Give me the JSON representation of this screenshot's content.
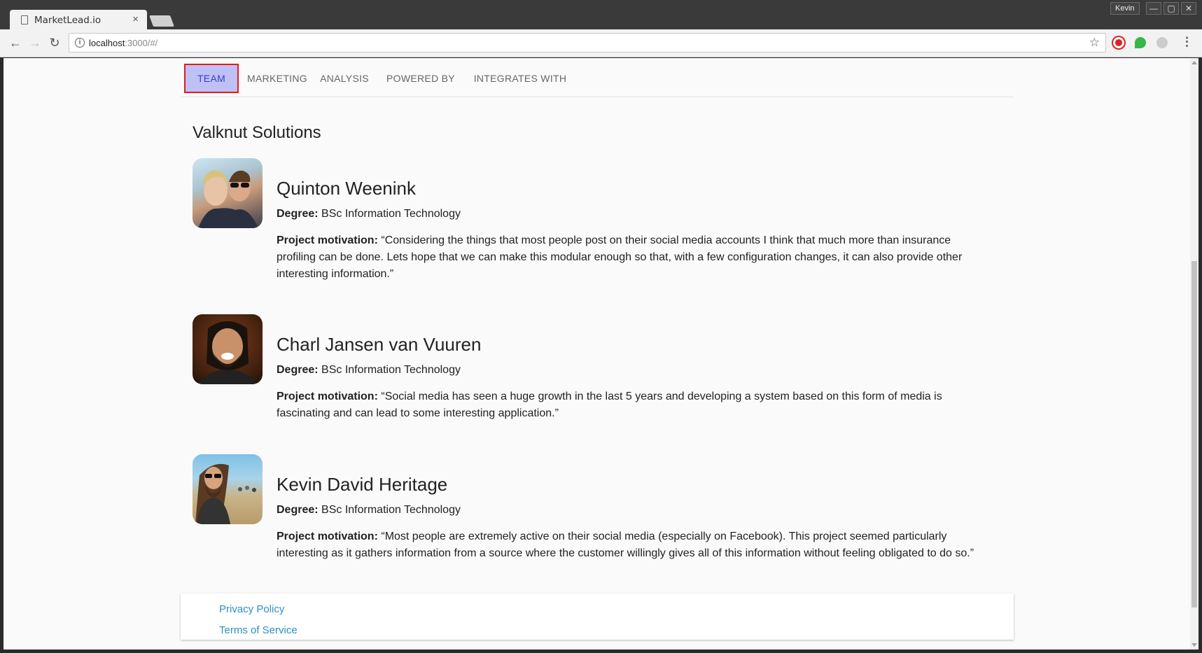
{
  "browser": {
    "tab_title": "MarketLead.io",
    "tab_close": "×",
    "user": "Kevin",
    "url_host": "localhost",
    "url_rest": ":3000/#/",
    "window_min": "—",
    "window_max": "▢",
    "window_close": "✕"
  },
  "tabs": [
    "TEAM",
    "MARKETING",
    "ANALYSIS",
    "POWERED BY",
    "INTEGRATES WITH"
  ],
  "company": "Valknut Solutions",
  "labels": {
    "degree": "Degree:",
    "motivation": "Project motivation:"
  },
  "members": [
    {
      "name": "Quinton Weenink",
      "degree": "BSc Information Technology",
      "motivation": "“Considering the things that most people post on their social media accounts I think that much more than insurance profiling can be done. Lets hope that we can make this modular enough so that, with a few configuration changes, it can also provide other interesting information.”"
    },
    {
      "name": "Charl Jansen van Vuuren",
      "degree": "BSc Information Technology",
      "motivation": "“Social media has seen a huge growth in the last 5 years and developing a system based on this form of media is fascinating and can lead to some interesting application.”"
    },
    {
      "name": "Kevin David Heritage",
      "degree": "BSc Information Technology",
      "motivation": "“Most people are extremely active on their social media (especially on Facebook). This project seemed particularly interesting as it gathers information from a source where the customer willingly gives all of this information without feeling obligated to do so.”"
    }
  ],
  "footer": {
    "privacy": "Privacy Policy",
    "terms": "Terms of Service"
  },
  "colors": {
    "active_tab_bg": "#bfc0f5",
    "active_tab_text": "#3c3fc2",
    "highlight_border": "#e11d1d",
    "link": "#2f8fc3"
  }
}
